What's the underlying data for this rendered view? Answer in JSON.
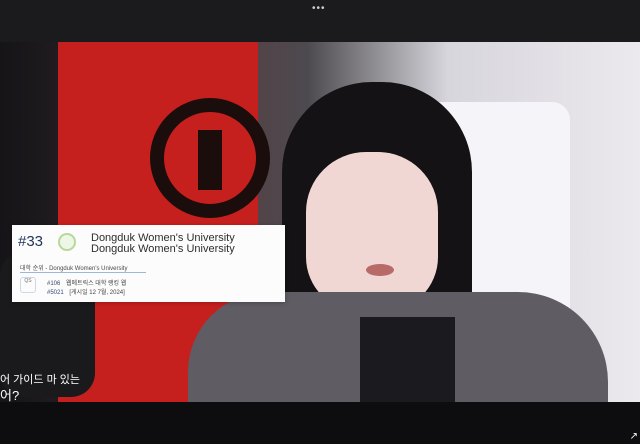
{
  "topbar": {
    "more_label": "•••"
  },
  "overlay_card": {
    "rank": "#33",
    "university_name": "Dongduk Women's University",
    "university_name_2": "Dongduk Women's University",
    "tab_label": "대학 순위 - Dongduk Women's University",
    "entries": [
      {
        "rank": "#106",
        "label": "웹메트릭스 대학 랭킹 웹"
      },
      {
        "rank": "#5021",
        "label": "[게시일 12 7월, 2024]"
      }
    ]
  },
  "subtitles": [
    {
      "text": "어 가이드 마 있는"
    },
    {
      "text": "어?"
    }
  ],
  "bottom_icon": {
    "glyph": "↗"
  },
  "colors": {
    "flag": "#c6201e",
    "card": "#fcfcfd",
    "rank": "#1d3557",
    "background": "#0d0c0e"
  },
  "icons": [
    "more-icon",
    "university-logo-icon",
    "ranking-badge-icon",
    "share-icon"
  ]
}
